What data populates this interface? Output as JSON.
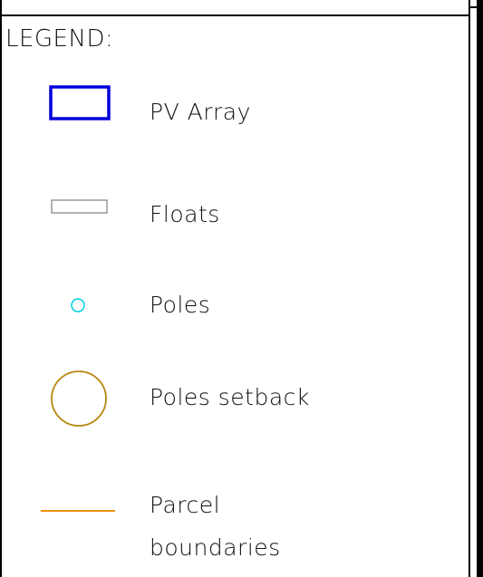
{
  "legend": {
    "title": "LEGEND:",
    "items": [
      {
        "label": "PV Array",
        "symbol": "rectangle",
        "stroke": "#0000dd"
      },
      {
        "label": "Floats",
        "symbol": "rectangle",
        "stroke": "#999999"
      },
      {
        "label": "Poles",
        "symbol": "circle",
        "stroke": "#00d0e0"
      },
      {
        "label": "Poles setback",
        "symbol": "circle",
        "stroke": "#b8860b"
      },
      {
        "label": "Parcel boundaries",
        "label_lines": [
          "Parcel",
          "boundaries"
        ],
        "symbol": "line",
        "stroke": "#f0900a"
      }
    ]
  },
  "colors": {
    "frame": "#000000",
    "background": "#ffffff",
    "text": "#111111"
  }
}
